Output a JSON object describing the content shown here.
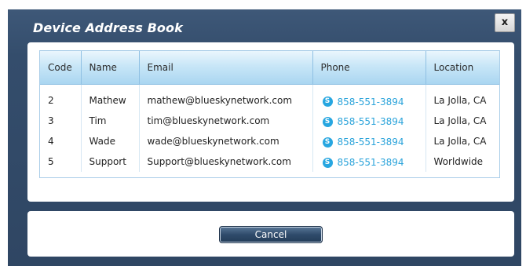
{
  "dialog": {
    "title": "Device Address Book",
    "close_label": "x"
  },
  "table": {
    "columns": [
      "Code",
      "Name",
      "Email",
      "Phone",
      "Location"
    ],
    "rows": [
      {
        "code": "2",
        "name": "Mathew",
        "email": "mathew@blueskynetwork.com",
        "phone": "858-551-3894",
        "location": "La Jolla, CA"
      },
      {
        "code": "3",
        "name": "Tim",
        "email": "tim@blueskynetwork.com",
        "phone": "858-551-3894",
        "location": "La Jolla, CA"
      },
      {
        "code": "4",
        "name": "Wade",
        "email": "wade@blueskynetwork.com",
        "phone": "858-551-3894",
        "location": "La Jolla, CA"
      },
      {
        "code": "5",
        "name": "Support",
        "email": "Support@blueskynetwork.com",
        "phone": "858-551-3894",
        "location": "Worldwide"
      }
    ],
    "phone_icon": "skype-icon",
    "phone_icon_glyph": "S"
  },
  "footer": {
    "cancel_label": "Cancel"
  },
  "colors": {
    "dialog_bg": "#344d6c",
    "header_bg": "#c8e6f7",
    "link": "#2aa3da",
    "skype": "#27a6e0"
  }
}
